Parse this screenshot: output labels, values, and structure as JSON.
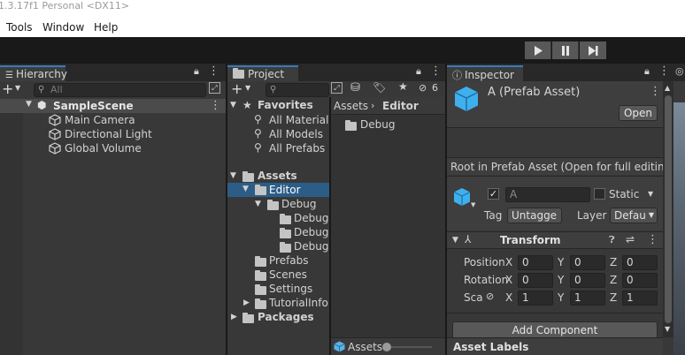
{
  "title_bar": {
    "text": "1.3.17f1 Personal <DX11>"
  },
  "menu": {
    "items": [
      "Tools",
      "Window",
      "Help"
    ]
  },
  "hierarchy": {
    "tab_label": "Hierarchy",
    "search_placeholder": "All",
    "scene_name": "SampleScene",
    "objects": [
      "Main Camera",
      "Directional Light",
      "Global Volume"
    ]
  },
  "project": {
    "tab_label": "Project",
    "hidden_count": "6",
    "favorites_label": "Favorites",
    "favorites": [
      "All Materials",
      "All Models",
      "All Prefabs"
    ],
    "assets_label": "Assets",
    "tree": {
      "editor": "Editor",
      "debug": "Debug",
      "debug_children": [
        "Debug",
        "Debug",
        "Debug"
      ],
      "prefabs": "Prefabs",
      "scenes": "Scenes",
      "settings": "Settings",
      "tutorialinfo": "TutorialInfo",
      "packages": "Packages"
    },
    "breadcrumb": [
      "Assets",
      "Editor"
    ],
    "content_items": [
      "Debug"
    ],
    "footer_path": "Assets"
  },
  "inspector": {
    "tab_label": "Inspector",
    "asset_title": "A (Prefab Asset)",
    "open_button": "Open",
    "info_text": "Root in Prefab Asset (Open for full editing s",
    "object_name": "A",
    "static_label": "Static",
    "tag_label": "Tag",
    "tag_value": "Untagge",
    "layer_label": "Layer",
    "layer_value": "Defau",
    "transform_label": "Transform",
    "position_label": "Position",
    "rotation_label": "Rotation",
    "scale_label": "Sca",
    "axis_x": "X",
    "axis_y": "Y",
    "axis_z": "Z",
    "position": [
      "0",
      "0",
      "0"
    ],
    "rotation": [
      "0",
      "0",
      "0"
    ],
    "scale": [
      "1",
      "1",
      "1"
    ],
    "add_component": "Add Component",
    "asset_labels": "Asset Labels"
  },
  "colors": {
    "accent": "#3a79bb",
    "selection": "#2c5d87",
    "panel": "#383838",
    "tabbar": "#282828"
  }
}
